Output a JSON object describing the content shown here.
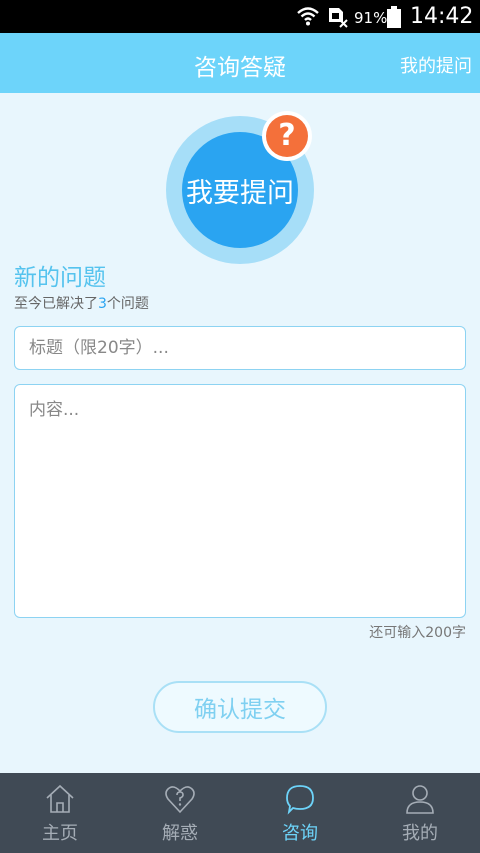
{
  "status_bar": {
    "battery_percent": "91%",
    "time": "14:42"
  },
  "app_bar": {
    "title": "咨询答疑",
    "right_link": "我的提问"
  },
  "ask_button": {
    "label": "我要提问",
    "badge": "?"
  },
  "new_question": {
    "heading": "新的问题",
    "solved_prefix": "至今已解决了",
    "solved_count": "3",
    "solved_suffix": "个问题"
  },
  "form": {
    "title_placeholder": "标题（限20字）...",
    "content_placeholder": "内容...",
    "remaining_text": "还可输入200字",
    "submit_label": "确认提交"
  },
  "tabs": [
    {
      "label": "主页",
      "icon": "home-icon",
      "active": false
    },
    {
      "label": "解惑",
      "icon": "heart-question-icon",
      "active": false
    },
    {
      "label": "咨询",
      "icon": "chat-bubble-icon",
      "active": true
    },
    {
      "label": "我的",
      "icon": "user-icon",
      "active": false
    }
  ],
  "colors": {
    "accent": "#6dd4fa",
    "primary": "#2aa4f1",
    "badge": "#f4703a",
    "tab_bar": "#404a55"
  }
}
